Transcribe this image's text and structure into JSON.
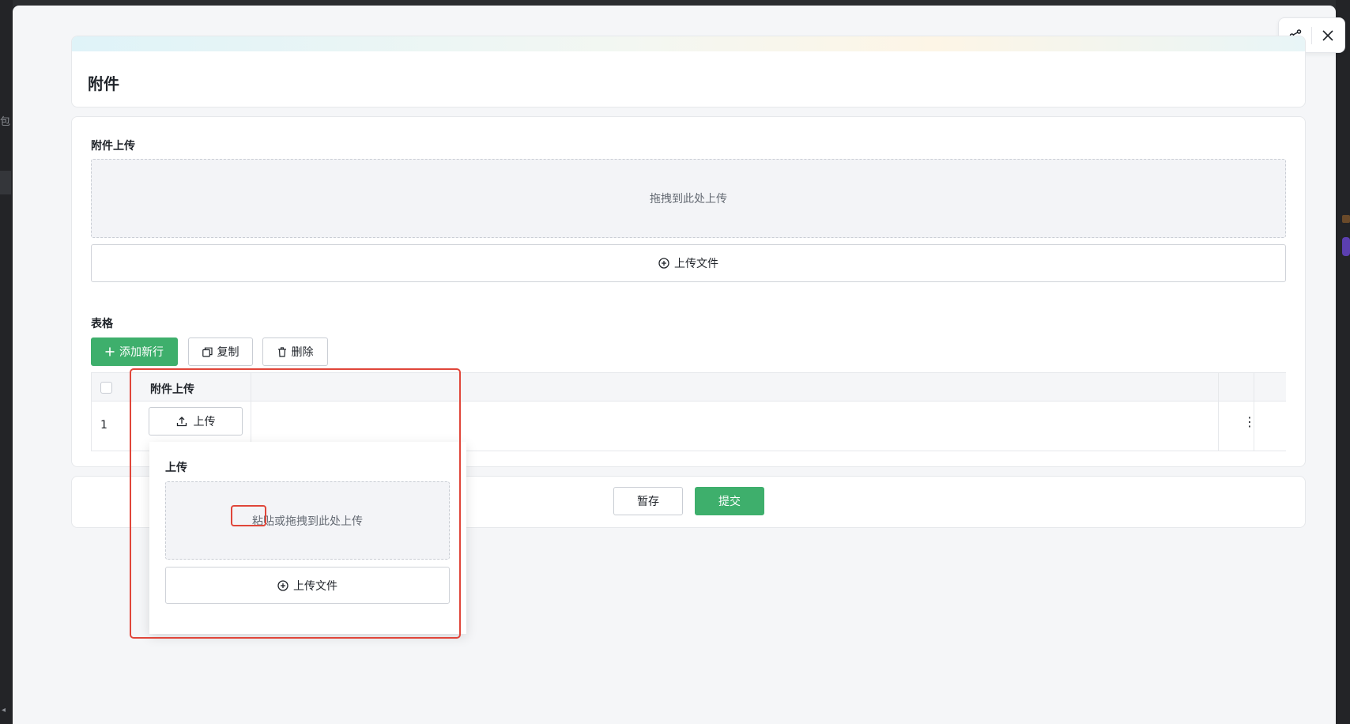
{
  "backdrop": {
    "left_glyph": "包"
  },
  "drawer": {
    "tools": {
      "share_icon": "share-icon",
      "close_icon": "close-icon"
    }
  },
  "page": {
    "title": "附件"
  },
  "attachment_section": {
    "label": "附件上传",
    "dropzone_text": "拖拽到此处上传",
    "upload_button_label": "上传文件"
  },
  "table_section": {
    "label": "表格",
    "toolbar": {
      "add_row_label": "添加新行",
      "copy_label": "复制",
      "delete_label": "删除"
    },
    "columns": [
      "附件上传"
    ],
    "rows": [
      {
        "index": "1",
        "upload_label": "上传"
      }
    ]
  },
  "actions": {
    "save_draft_label": "暂存",
    "submit_label": "提交"
  },
  "popover": {
    "title": "上传",
    "dropzone_text_highlighted": "粘贴",
    "dropzone_text_rest": "或拖拽到此处上传",
    "upload_button_label": "上传文件"
  },
  "colors": {
    "accent": "#3eaf6c",
    "highlight": "#e0463a"
  }
}
